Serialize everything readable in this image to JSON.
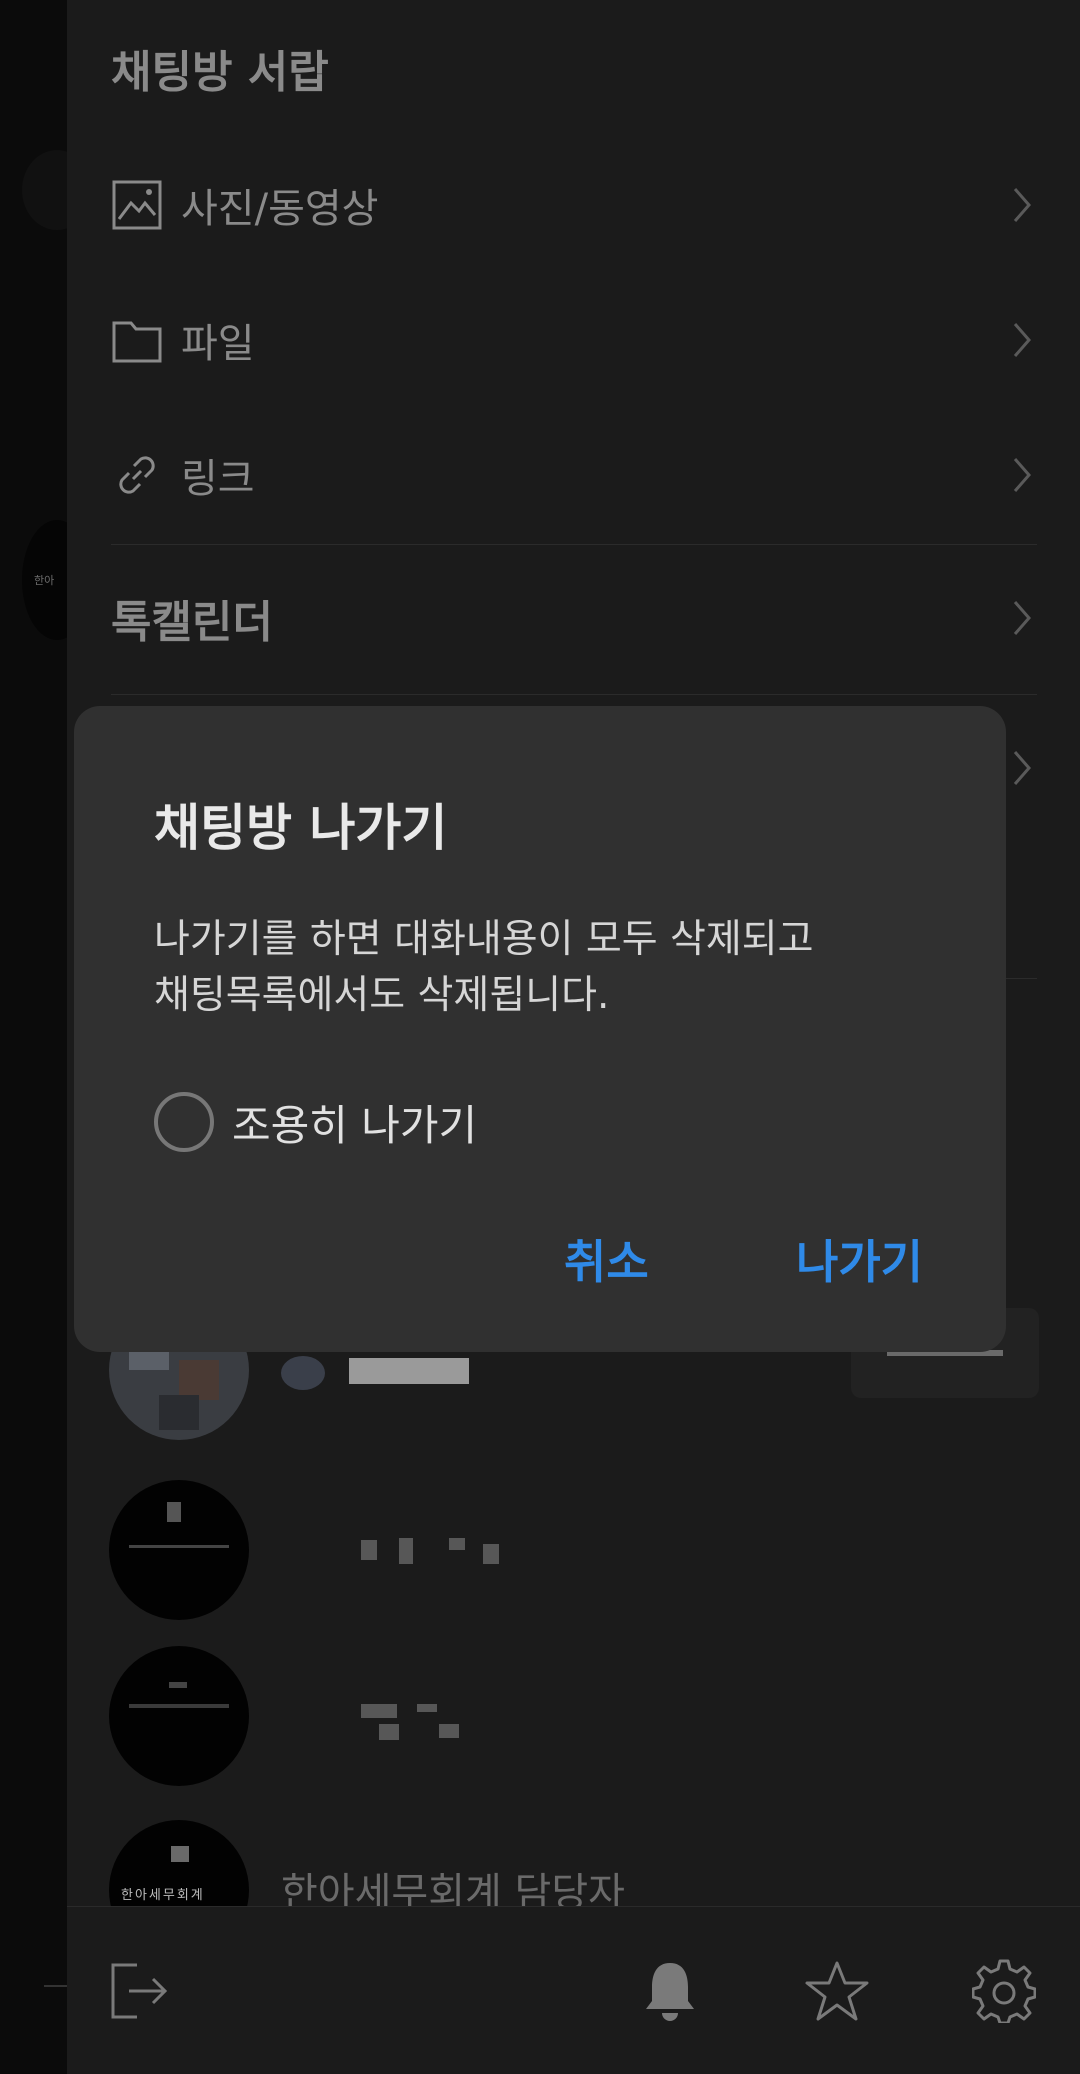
{
  "drawer": {
    "title": "채팅방 서랍",
    "items": [
      {
        "label": "사진/동영상",
        "icon": "image-icon"
      },
      {
        "label": "파일",
        "icon": "folder-icon"
      },
      {
        "label": "링크",
        "icon": "link-icon"
      }
    ],
    "calendar_label": "톡캘린더"
  },
  "members": [
    {
      "name": "",
      "badge": ""
    },
    {
      "name": ""
    },
    {
      "name": ""
    },
    {
      "name": "한아세무회계 담당자",
      "avatar_text": "한아세무회계"
    }
  ],
  "left_strip": {
    "avatar_text": "한아"
  },
  "footer": {
    "icons": [
      "exit-icon",
      "bell-icon",
      "star-icon",
      "gear-icon"
    ]
  },
  "dialog": {
    "title": "채팅방 나가기",
    "message_line1": "나가기를 하면 대화내용이 모두 삭제되고",
    "message_line2": "채팅목록에서도 삭제됩니다.",
    "quiet_leave_label": "조용히 나가기",
    "cancel_label": "취소",
    "leave_label": "나가기"
  },
  "colors": {
    "accent": "#2f8ae8",
    "dialog_bg": "#303030",
    "drawer_bg": "#1b1b1b"
  }
}
